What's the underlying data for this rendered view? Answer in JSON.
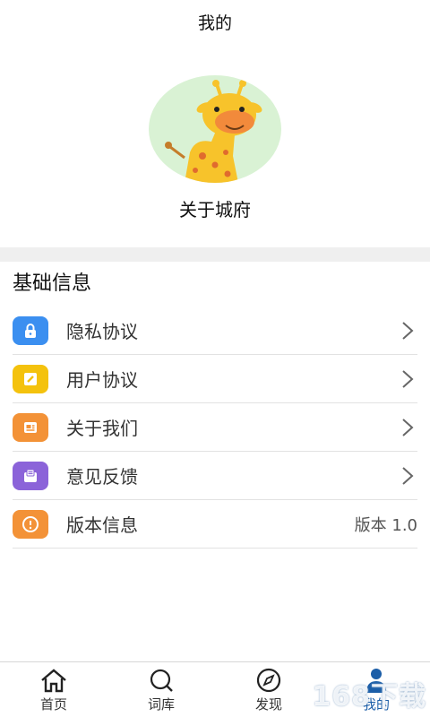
{
  "header": {
    "title": "我的"
  },
  "profile": {
    "name": "关于城府"
  },
  "section": {
    "title": "基础信息"
  },
  "rows": [
    {
      "label": "隐私协议",
      "icon": "lock-icon",
      "color": "#3b8ff0",
      "right": ""
    },
    {
      "label": "用户协议",
      "icon": "edit-icon",
      "color": "#f4c20d",
      "right": ""
    },
    {
      "label": "关于我们",
      "icon": "info-card-icon",
      "color": "#f39237",
      "right": ""
    },
    {
      "label": "意见反馈",
      "icon": "mail-icon",
      "color": "#8b63d9",
      "right": ""
    },
    {
      "label": "版本信息",
      "icon": "info-circle-icon",
      "color": "#f39237",
      "right": "版本 1.0"
    }
  ],
  "tabs": [
    {
      "label": "首页",
      "icon": "home-icon"
    },
    {
      "label": "词库",
      "icon": "search-icon"
    },
    {
      "label": "发现",
      "icon": "compass-icon"
    },
    {
      "label": "我的",
      "icon": "user-icon",
      "active": true
    }
  ],
  "watermark": "168下载"
}
